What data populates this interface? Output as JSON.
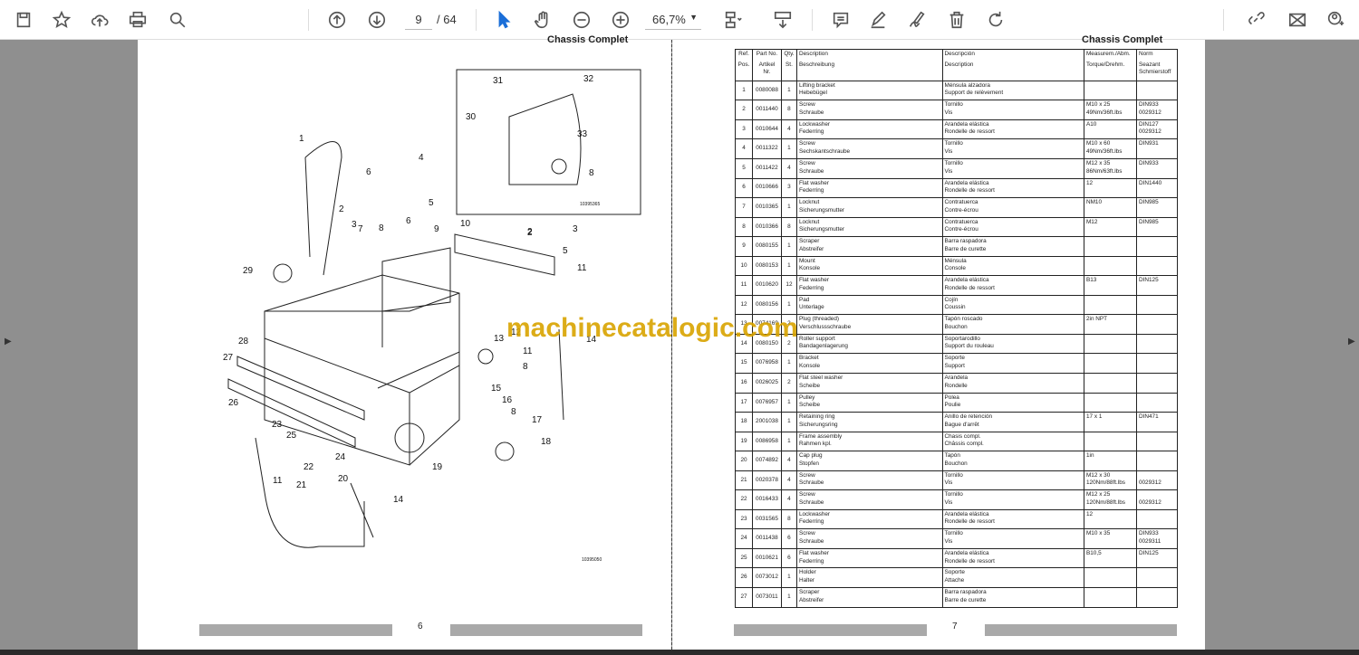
{
  "toolbar": {
    "page_current": "9",
    "page_total": "/ 64",
    "zoom": "66,7%",
    "icons": [
      "save-icon",
      "bookmark-star-icon",
      "upload-cloud-icon",
      "print-icon",
      "find-icon",
      "page-up-icon",
      "page-down-icon",
      "select-cursor-icon",
      "hand-pan-icon",
      "zoom-out-icon",
      "zoom-in-icon",
      "fit-page-icon",
      "scroll-mode-icon",
      "comment-icon",
      "highlight-icon",
      "sign-icon",
      "delete-icon",
      "rotate-icon",
      "link-icon",
      "email-icon",
      "account-icon"
    ]
  },
  "left_page": {
    "title": "Chassis Complet",
    "page_number": "6",
    "inset_code": "10395365",
    "main_code": "10395050",
    "callouts": [
      "1",
      "2",
      "3",
      "4",
      "5",
      "6",
      "6",
      "7",
      "8",
      "2",
      "3",
      "29",
      "9",
      "10",
      "2",
      "5",
      "11",
      "28",
      "27",
      "26",
      "13",
      "12",
      "11",
      "8",
      "14",
      "15",
      "16",
      "8",
      "17",
      "18",
      "19",
      "23",
      "25",
      "22",
      "24",
      "11",
      "21",
      "20",
      "14",
      "31",
      "32",
      "30",
      "33",
      "8"
    ]
  },
  "right_page": {
    "title": "Chassis Complet",
    "page_number": "7",
    "headers": [
      [
        "Ref.",
        "Pos."
      ],
      [
        "Part No.",
        "Artikel Nr."
      ],
      [
        "Qty.",
        "St."
      ],
      [
        "Description",
        "Beschreibung"
      ],
      [
        "Descripción",
        "Description"
      ],
      [
        "Measurem./Abm.",
        "Torque/Drehm."
      ],
      [
        "Norm",
        "Seazant Schmierstoff"
      ]
    ],
    "rows": [
      [
        "1",
        "0080088",
        "1",
        "Lifting bracket",
        "Hebebügel",
        "Ménsula alzadora",
        "Support de relèvement",
        "",
        ""
      ],
      [
        "2",
        "0011440",
        "8",
        "Screw",
        "Schraube",
        "Tornillo",
        "Vis",
        "M10 x 25\n49Nm/36ft.lbs",
        "DIN933\n0029312"
      ],
      [
        "3",
        "0010644",
        "4",
        "Lockwasher",
        "Federring",
        "Arandela elástica",
        "Rondelle de ressort",
        "A10",
        "DIN127\n0029312"
      ],
      [
        "4",
        "0011322",
        "1",
        "Screw",
        "Sechskantschraube",
        "Tornillo",
        "Vis",
        "M10 x 60\n49Nm/36ft.lbs",
        "DIN931"
      ],
      [
        "5",
        "0011422",
        "4",
        "Screw",
        "Schraube",
        "Tornillo",
        "Vis",
        "M12 x 35\n86Nm/63ft.lbs",
        "DIN933"
      ],
      [
        "6",
        "0010666",
        "3",
        "Flat washer",
        "Federring",
        "Arandela elástica",
        "Rondelle de ressort",
        "12",
        "DIN1440"
      ],
      [
        "7",
        "0010365",
        "1",
        "Locknut",
        "Sicherungsmutter",
        "Contratuerca",
        "Contre-écrou",
        "NM10",
        "DIN985"
      ],
      [
        "8",
        "0010366",
        "8",
        "Locknut",
        "Sicherungsmutter",
        "Contratuerca",
        "Contre-écrou",
        "M12",
        "DIN985"
      ],
      [
        "9",
        "0080155",
        "1",
        "Scraper",
        "Abstreifer",
        "Barra raspadora",
        "Barre de curette",
        "",
        ""
      ],
      [
        "10",
        "0080153",
        "1",
        "Mount",
        "Konsole",
        "Ménsula",
        "Console",
        "",
        ""
      ],
      [
        "11",
        "0010620",
        "12",
        "Flat washer",
        "Federring",
        "Arandela elástica",
        "Rondelle de ressort",
        "B13",
        "DIN125"
      ],
      [
        "12",
        "0080156",
        "1",
        "Pad",
        "Unterlage",
        "Cojín",
        "Coussin",
        "",
        ""
      ],
      [
        "13",
        "0074169",
        "2",
        "Plug (threaded)",
        "Verschlussschraube",
        "Tapón roscado",
        "Bouchon",
        "2in NPT",
        ""
      ],
      [
        "14",
        "0080150",
        "2",
        "Roller support",
        "Bandagenlagerung",
        "Soportarodillo",
        "Support du rouleau",
        "",
        ""
      ],
      [
        "15",
        "0076958",
        "1",
        "Bracket",
        "Konsole",
        "Soporte",
        "Support",
        "",
        ""
      ],
      [
        "16",
        "0026025",
        "2",
        "Flat steel washer",
        "Scheibe",
        "Arandela",
        "Rondelle",
        "",
        ""
      ],
      [
        "17",
        "0076957",
        "1",
        "Pulley",
        "Scheibe",
        "Polea",
        "Poulie",
        "",
        ""
      ],
      [
        "18",
        "2001038",
        "1",
        "Retaining ring",
        "Sicherungsring",
        "Anillo de retención",
        "Bague d'arrêt",
        "17 x 1",
        "DIN471"
      ],
      [
        "19",
        "0086958",
        "1",
        "Frame assembly",
        "Rahmen kpl.",
        "Chasis compl.",
        "Châssis compl.",
        "",
        ""
      ],
      [
        "20",
        "0074892",
        "4",
        "Cap plug",
        "Stopfen",
        "Tapón",
        "Bouchon",
        "1in",
        ""
      ],
      [
        "21",
        "0020378",
        "4",
        "Screw",
        "Schraube",
        "Tornillo",
        "Vis",
        "M12 x 30\n120Nm/88ft.lbs",
        "\n0029312"
      ],
      [
        "22",
        "0016433",
        "4",
        "Screw",
        "Schraube",
        "Tornillo",
        "Vis",
        "M12 x 25\n120Nm/88ft.lbs",
        "\n0029312"
      ],
      [
        "23",
        "0031565",
        "8",
        "Lockwasher",
        "Federring",
        "Arandela elástica",
        "Rondelle de ressort",
        "12",
        ""
      ],
      [
        "24",
        "0011438",
        "6",
        "Screw",
        "Schraube",
        "Tornillo",
        "Vis",
        "M10 x 35",
        "DIN933\n0029311"
      ],
      [
        "25",
        "0010621",
        "6",
        "Flat washer",
        "Federring",
        "Arandela elástica",
        "Rondelle de ressort",
        "B10,5",
        "DIN125"
      ],
      [
        "26",
        "0073012",
        "1",
        "Holder",
        "Halter",
        "Soporte",
        "Attache",
        "",
        ""
      ],
      [
        "27",
        "0073011",
        "1",
        "Scraper",
        "Abstreifer",
        "Barra raspadora",
        "Barre de curette",
        "",
        ""
      ]
    ]
  },
  "watermark": "machinecatalogic.com"
}
